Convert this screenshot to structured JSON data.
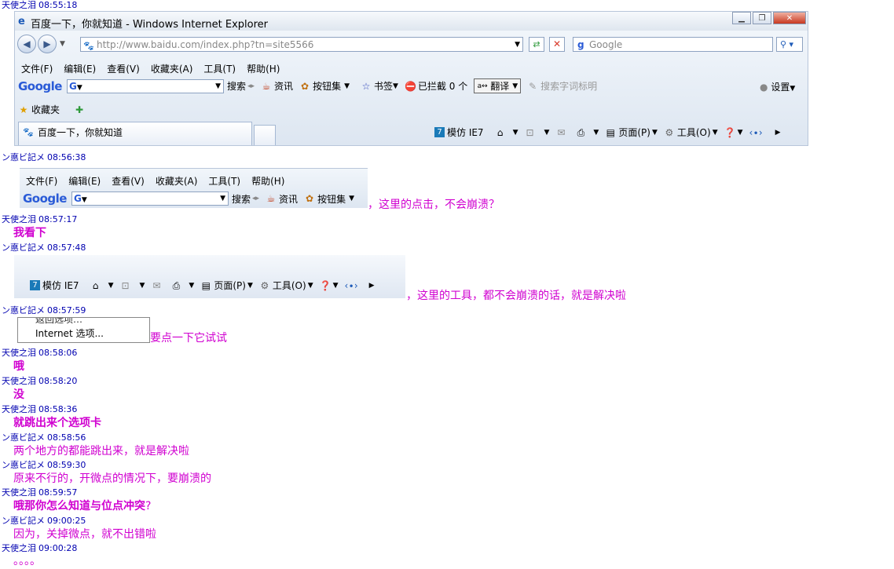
{
  "messages": [
    {
      "sender": "天使之泪",
      "time": "08:55:18"
    },
    {
      "sender": "ン悳ビ記メ",
      "time": "08:56:38",
      "text": "，这里的点击，不会崩溃？"
    },
    {
      "sender": "天使之泪",
      "time": "08:57:17",
      "text": "我看下"
    },
    {
      "sender": "ン悳ビ記メ",
      "time": "08:57:48",
      "text": "，这里的工具，都不会崩溃的话，就是解决啦"
    },
    {
      "sender": "ン悳ビ記メ",
      "time": "08:57:59",
      "text": "要点一下它试试"
    },
    {
      "sender": "天使之泪",
      "time": "08:58:06",
      "text": "哦"
    },
    {
      "sender": "天使之泪",
      "time": "08:58:20",
      "text": "没"
    },
    {
      "sender": "天使之泪",
      "time": "08:58:36",
      "text": "就跳出来个选项卡"
    },
    {
      "sender": "ン悳ビ記メ",
      "time": "08:58:56",
      "text": "两个地方的都能跳出来，就是解决啦"
    },
    {
      "sender": "ン悳ビ記メ",
      "time": "08:59:30",
      "text": "原来不行的，开微点的情况下，要崩溃的"
    },
    {
      "sender": "天使之泪",
      "time": "08:59:57",
      "text": "哦那你怎么知道与位点冲突",
      "text_suffix": "?"
    },
    {
      "sender": "ン悳ビ記メ",
      "time": "09:00:25",
      "text": "因为，关掉微点，就不出错啦"
    },
    {
      "sender": "天使之泪",
      "time": "09:00:28",
      "text": "。。。。"
    }
  ],
  "ie": {
    "title": "百度一下，你就知道 - Windows Internet Explorer",
    "address": "http://www.baidu.com/index.php?tn=site5566",
    "search_placeholder": "Google",
    "menu": [
      "文件(F)",
      "编辑(E)",
      "查看(V)",
      "收藏夹(A)",
      "工具(T)",
      "帮助(H)"
    ],
    "google_toolbar": {
      "logo": "Google",
      "g_button": "G",
      "search": "搜索",
      "news": "资讯",
      "buttons": "按钮集",
      "bookmarks": "书签",
      "blocked": "已拦截 0 个",
      "translate": "翻译",
      "highlight": "搜索字词标明",
      "settings": "设置"
    },
    "favorites": "收藏夹",
    "tab_label": "百度一下，你就知道",
    "commandbar": {
      "mimic": "模仿 IE7",
      "mimic_badge": "7",
      "page": "页面(P)",
      "tools": "工具(O)"
    }
  },
  "snip1": {
    "menu": [
      "文件(F)",
      "编辑(E)",
      "查看(V)",
      "收藏夹(A)",
      "工具(T)",
      "帮助(H)"
    ],
    "google": "Google",
    "g_button": "G",
    "search": "搜索",
    "news": "资讯",
    "buttons": "按钮集"
  },
  "snip2": {
    "mimic": "模仿 IE7",
    "mimic_badge": "7",
    "page": "页面(P)",
    "tools": "工具(O)"
  },
  "snip3": {
    "item_partial": "返回选项…",
    "item": "Internet 选项..."
  },
  "colors": {
    "sender": "#0000b0",
    "message": "#d000d0"
  }
}
